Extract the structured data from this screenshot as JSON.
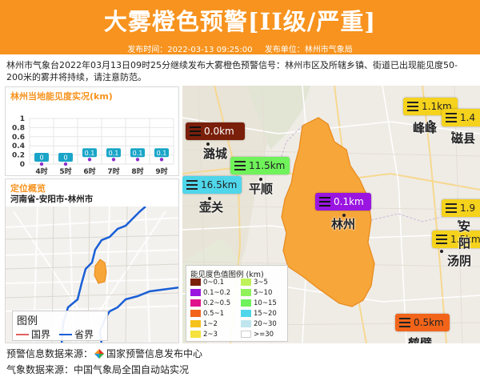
{
  "header": {
    "title": "大雾橙色预警[II级/严重]",
    "publish_time_label": "发布时间：2022-03-13 09:25:00",
    "publisher_label": "发布单位：林州市气象局"
  },
  "description": "林州市气象台2022年03月13日09时25分继续发布大雾橙色预警信号：林州市区及所辖乡镇、街道已出现能见度50-200米的雾并将持续，请注意防范。",
  "visibility_panel": {
    "title": "林州当地能见度实况(km)"
  },
  "chart_data": {
    "type": "bar",
    "title": "林州当地能见度实况(km)",
    "categories": [
      "4时",
      "5时",
      "6时",
      "7时",
      "8时",
      "9时"
    ],
    "values": [
      0,
      0,
      0.1,
      0.1,
      0.1,
      0.1
    ],
    "data_labels": [
      "0",
      "0",
      "0.1",
      "0.1",
      "0.1",
      "0.1"
    ],
    "ylim": [
      0,
      1
    ],
    "yticks": [
      "1",
      "0.8",
      "0.6",
      "0.4",
      "0.2",
      "0"
    ],
    "grid": true,
    "colors": {
      "label_box": "#1aa5c8",
      "point": "#8b2fc9"
    }
  },
  "location_panel": {
    "title": "定位概览",
    "location": "河南省-安阳市-林州市",
    "legend_title": "图例",
    "legend_items": [
      {
        "label": "国界",
        "color": "#e06060"
      },
      {
        "label": "省界",
        "color": "#1a5fd6"
      }
    ]
  },
  "map": {
    "stations": [
      {
        "value": "0.0km",
        "color": "#7a1f0a",
        "text": "dark"
      },
      {
        "value": "11.5km",
        "color": "#6ff25a",
        "text": "light"
      },
      {
        "value": "16.5km",
        "color": "#4fd6ea",
        "text": "light"
      },
      {
        "value": "0.1km",
        "color": "#9a16e0",
        "text": "dark"
      },
      {
        "value": "1.1km",
        "color": "#f5d21c",
        "text": "light"
      },
      {
        "value": "1.4",
        "color": "#f5d21c",
        "text": "light"
      },
      {
        "value": "1.9",
        "color": "#f5d21c",
        "text": "light"
      },
      {
        "value": "1.5km",
        "color": "#f5d21c",
        "text": "light"
      },
      {
        "value": "0.5km",
        "color": "#f26419",
        "text": "light"
      }
    ],
    "cities": [
      "潞城",
      "平顺",
      "壶关",
      "林州",
      "峰峰",
      "磁县",
      "安阳",
      "汤阴",
      "鹤壁"
    ],
    "legend": {
      "title": "能见度色值图例 (km)",
      "items": [
        {
          "label": "0~0.1",
          "color": "#7a1f0a"
        },
        {
          "label": "3~5",
          "color": "#bff25a"
        },
        {
          "label": "0.1~0.2",
          "color": "#9a16e0"
        },
        {
          "label": "5~10",
          "color": "#8ff25a"
        },
        {
          "label": "0.2~0.5",
          "color": "#e0128c"
        },
        {
          "label": "10~15",
          "color": "#6ff25a"
        },
        {
          "label": "0.5~1",
          "color": "#f26419"
        },
        {
          "label": "15~20",
          "color": "#4fd6ea"
        },
        {
          "label": "1~2",
          "color": "#f5c21c"
        },
        {
          "label": "20~30",
          "color": "#bfe6ee"
        },
        {
          "label": "2~3",
          "color": "#f5e23c"
        },
        {
          "label": ">=30",
          "color": "#ffffff"
        }
      ]
    }
  },
  "footer": {
    "warning_source": "预警信息数据来源：",
    "warning_source_org": "国家预警信息发布中心",
    "weather_source": "气象数据来源：中国气象局全国自动站实况"
  }
}
